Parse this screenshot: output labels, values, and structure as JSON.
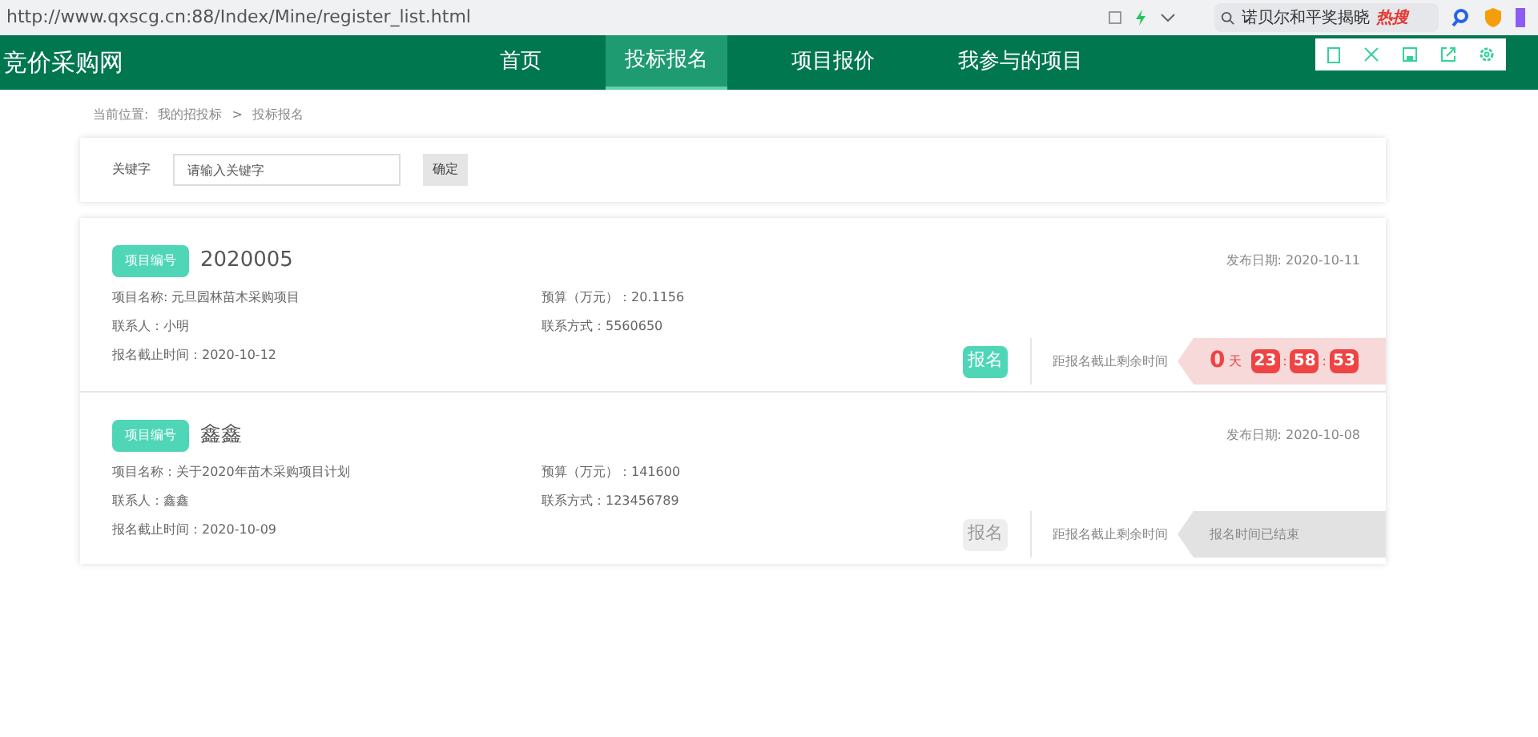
{
  "browser": {
    "url": "http://www.qxscg.cn:88/Index/Mine/register_list.html",
    "search_text": "诺贝尔和平奖揭晓",
    "hot_label": "热搜"
  },
  "site": {
    "logo": "竞价采购网"
  },
  "nav": [
    {
      "label": "首页",
      "selected": false
    },
    {
      "label": "投标报名",
      "selected": true
    },
    {
      "label": "项目报价",
      "selected": false
    },
    {
      "label": "我参与的项目",
      "selected": false
    }
  ],
  "breadcrumb": {
    "prefix": "当前位置:",
    "items": [
      "我的招投标",
      "投标报名"
    ],
    "separator": ">"
  },
  "filter": {
    "label": "关键字",
    "placeholder": "请输入关键字",
    "button": "确定"
  },
  "projects": [
    {
      "tag": "项目编号",
      "number": "2020005",
      "publish_date": "发布日期: 2020-10-11",
      "name": "项目名称:  元旦园林苗木采购项目",
      "budget": "预算（万元）：20.1156",
      "contact": "联系人：小明",
      "phone": "联系方式：5560650",
      "deadline": "报名截止时间：2020-10-12",
      "button": "报名",
      "disabled": false,
      "remaining_label": "距报名截止剩余时间",
      "countdown": {
        "kind": "running",
        "days": "0",
        "days_unit": "天",
        "hours": "23",
        "minutes": "58",
        "seconds": "53",
        "sep1": ":",
        "sep2": ":"
      }
    },
    {
      "tag": "项目编号",
      "number": "鑫鑫",
      "publish_date": "发布日期: 2020-10-08",
      "name": "项目名称：关于2020年苗木采购项目计划",
      "budget": "预算（万元）：141600",
      "contact": "联系人：鑫鑫",
      "phone": "联系方式：123456789",
      "deadline": "报名截止时间：2020-10-09",
      "button": "报名",
      "disabled": true,
      "remaining_label": "距报名截止剩余时间",
      "countdown": {
        "kind": "ended",
        "text": "报名时间已结束"
      }
    }
  ]
}
